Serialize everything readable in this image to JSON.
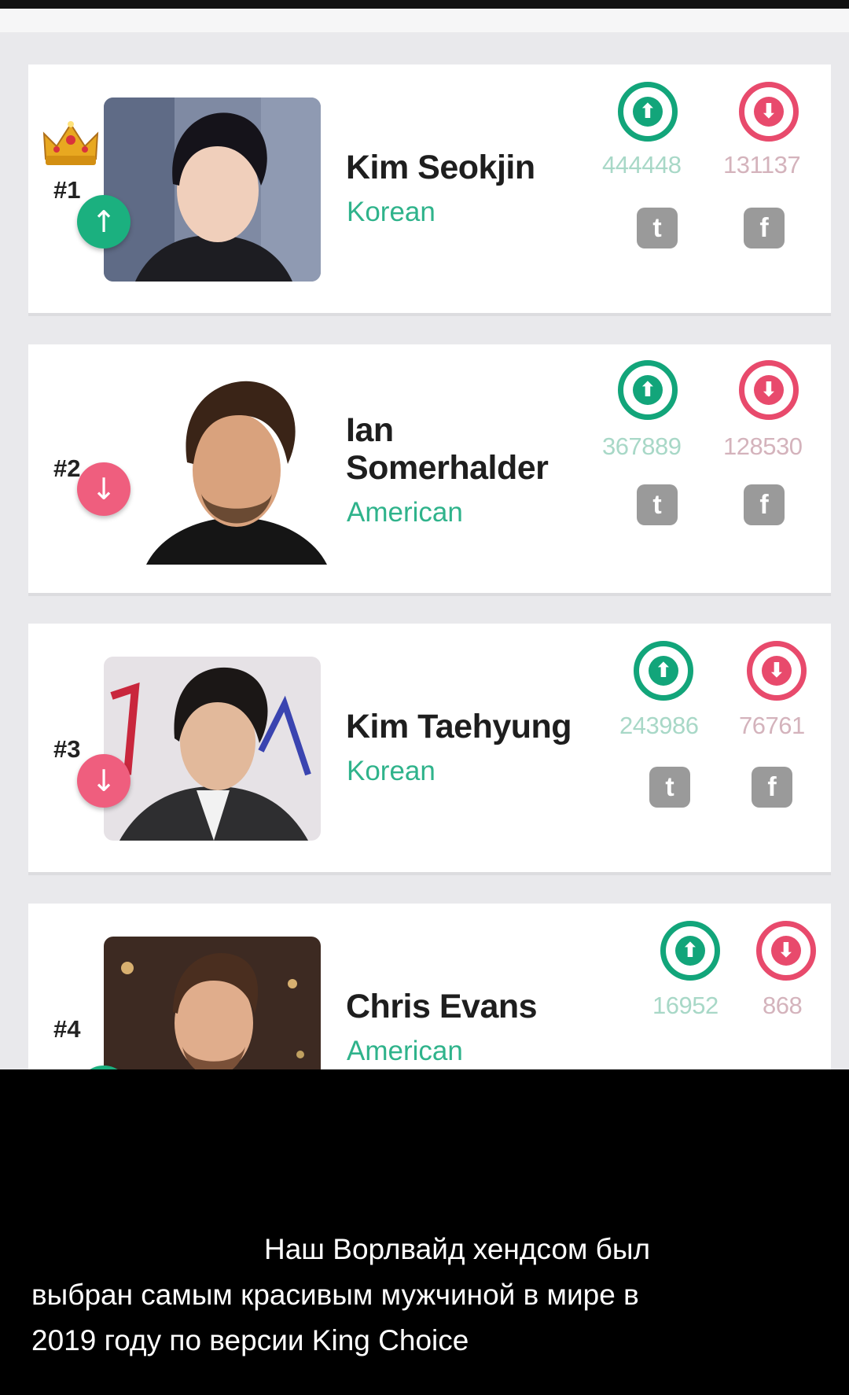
{
  "rankings": [
    {
      "rank": "#1",
      "name_line1": "Kim Seokjin",
      "name_line2": "",
      "nationality": "Korean",
      "trend": "up",
      "trend_icon": "arrow-up-icon",
      "up_votes": "444448",
      "down_votes": "131137",
      "crowned": true
    },
    {
      "rank": "#2",
      "name_line1": "Ian",
      "name_line2": "Somerhalder",
      "nationality": "American",
      "trend": "down",
      "trend_icon": "arrow-down-icon",
      "up_votes": "367889",
      "down_votes": "128530",
      "crowned": false
    },
    {
      "rank": "#3",
      "name_line1": "Kim Taehyung",
      "name_line2": "",
      "nationality": "Korean",
      "trend": "down",
      "trend_icon": "arrow-down-icon",
      "up_votes": "243986",
      "down_votes": "76761",
      "crowned": false
    },
    {
      "rank": "#4",
      "name_line1": "Chris Evans",
      "name_line2": "",
      "nationality": "American",
      "trend": "up",
      "trend_icon": "arrow-up-icon",
      "up_votes": "16952",
      "down_votes": "868",
      "crowned": false
    }
  ],
  "icons": {
    "upvote": "upvote-icon",
    "downvote": "downvote-icon",
    "twitter": "twitter-icon",
    "facebook": "facebook-icon",
    "crown": "crown-icon"
  },
  "colors": {
    "accent_green": "#12a57a",
    "accent_pink": "#e84a6c",
    "nationality_text": "#2fb38b"
  },
  "caption": {
    "line1": "Наш Ворлвайд хендсом был",
    "line2": "выбран самым красивым мужчиной в мире в",
    "line3": "2019 году по версии King Choice"
  }
}
